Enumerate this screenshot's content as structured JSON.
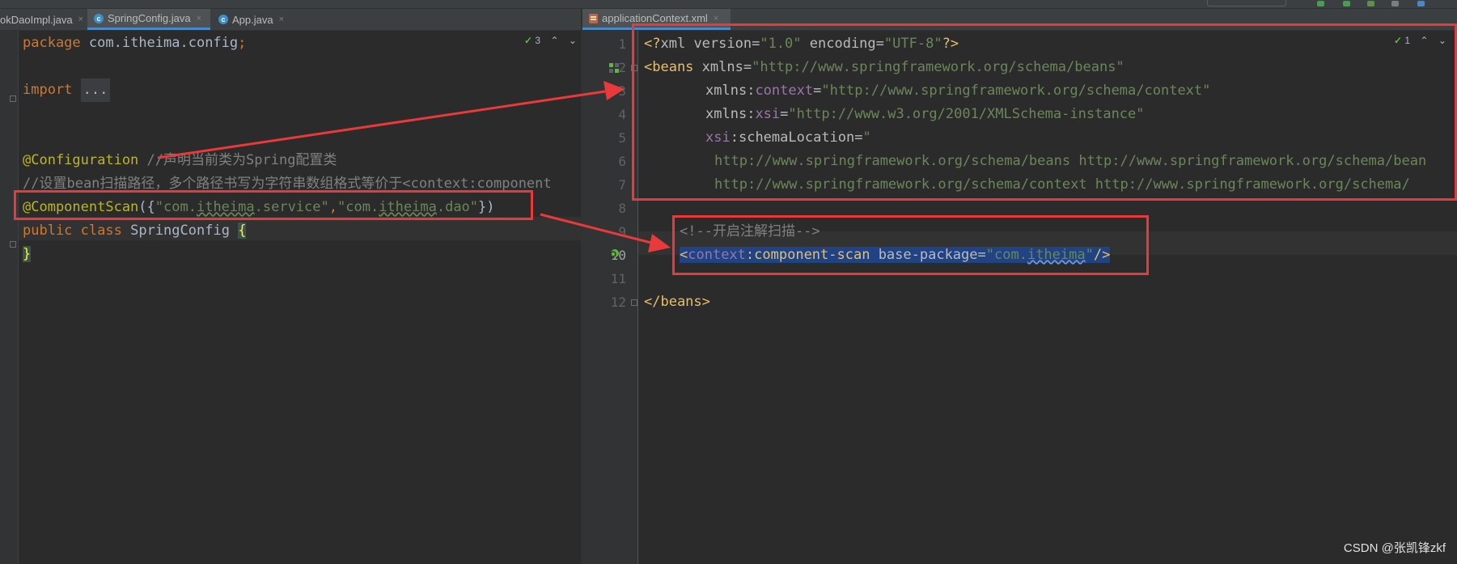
{
  "left_editor": {
    "tabs": [
      {
        "label": "okDaoImpl.java",
        "close": "×"
      },
      {
        "label": "SpringConfig.java",
        "close": "×",
        "active": true
      },
      {
        "label": "App.java",
        "close": "×"
      }
    ],
    "inspection": {
      "count": "3",
      "up": "⌃",
      "down": "⌄"
    },
    "code": {
      "package_kw": "package",
      "package_name": "com.itheima.config",
      "semicolon": ";",
      "import_kw": "import",
      "import_fold": "...",
      "configuration_ann": "@Configuration",
      "configuration_comment": "//声明当前类为Spring配置类",
      "scan_comment": "//设置bean扫描路径，多个路径书写为字符串数组格式等价于<context:component",
      "componentscan_ann": "@ComponentScan",
      "componentscan_open": "({",
      "componentscan_str1_a": "\"com.",
      "componentscan_str1_b": "itheima",
      "componentscan_str1_c": ".service\"",
      "componentscan_comma": ",",
      "componentscan_str2_a": "\"com.",
      "componentscan_str2_b": "itheima",
      "componentscan_str2_c": ".dao\"",
      "componentscan_close": "})",
      "public_kw": "public",
      "class_kw": "class",
      "class_name": "SpringConfig",
      "open_brace": "{",
      "close_brace": "}"
    }
  },
  "right_editor": {
    "tabs": [
      {
        "label": "applicationContext.xml",
        "close": "×",
        "active": true
      }
    ],
    "inspection": {
      "count": "1",
      "up": "⌃",
      "down": "⌄"
    },
    "line_numbers": [
      "1",
      "2",
      "3",
      "4",
      "5",
      "6",
      "7",
      "8",
      "9",
      "10",
      "11",
      "12"
    ],
    "code": {
      "l1_open": "<?",
      "l1_xml": "xml",
      "l1_version_attr": " version",
      "l1_eq1": "=",
      "l1_version_val": "\"1.0\"",
      "l1_enc_attr": " encoding",
      "l1_eq2": "=",
      "l1_enc_val": "\"UTF-8\"",
      "l1_close": "?>",
      "l2_tag": "<beans",
      "l2_attr": " xmlns",
      "l2_eq": "=",
      "l2_val": "\"http://www.springframework.org/schema/beans\"",
      "l3_attr": "xmlns",
      "l3_colon": ":",
      "l3_ns": "context",
      "l3_eq": "=",
      "l3_val": "\"http://www.springframework.org/schema/context\"",
      "l4_attr": "xmlns",
      "l4_colon": ":",
      "l4_ns": "xsi",
      "l4_eq": "=",
      "l4_val": "\"http://www.w3.org/2001/XMLSchema-instance\"",
      "l5_ns": "xsi",
      "l5_colon": ":",
      "l5_attr": "schemaLocation",
      "l5_eq": "=",
      "l5_val": "\"",
      "l6_val": "http://www.springframework.org/schema/beans http://www.springframework.org/schema/bean",
      "l7_val": "http://www.springframework.org/schema/context http://www.springframework.org/schema/",
      "l9_comment": "<!--开启注解扫描-->",
      "l10_lt": "<",
      "l10_ns": "context",
      "l10_colon": ":",
      "l10_tag": "component-scan",
      "l10_attr": " base-package",
      "l10_eq": "=",
      "l10_val_a": "\"com.",
      "l10_val_b": "itheima",
      "l10_val_c": "\"",
      "l10_close": "/>",
      "l12_tag": "</beans>"
    }
  },
  "watermark": "CSDN @张凯锋zkf",
  "colors": {
    "annotation_box": "#e83a3a",
    "arrow": "#e83a3a",
    "selection": "#214283"
  }
}
